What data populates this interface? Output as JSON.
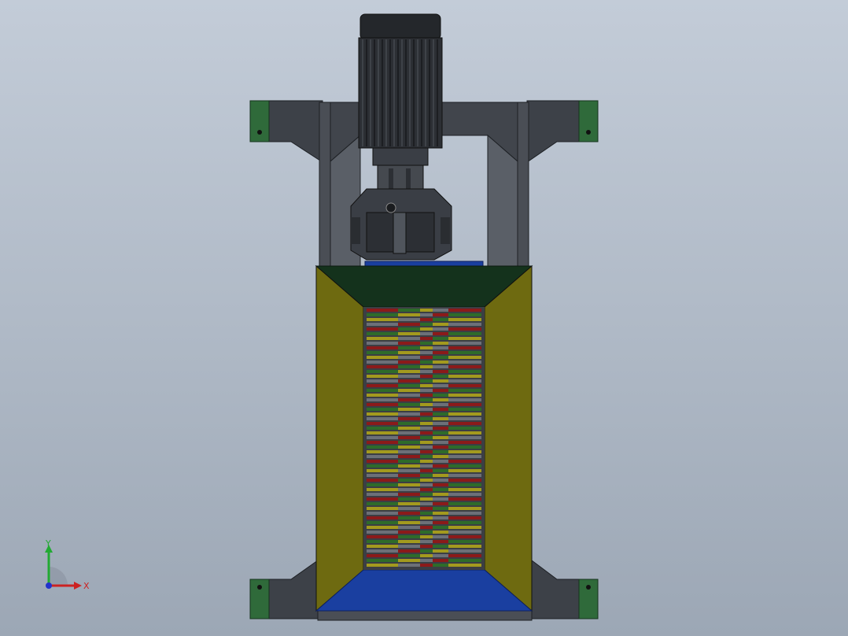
{
  "viewport": {
    "model": "shredder-assembly",
    "background_top": "#c3ccd8",
    "background_bottom": "#9ca7b5"
  },
  "colors": {
    "frame": "#3d4148",
    "frame_light": "#5a5f67",
    "motor": "#2c2f34",
    "gearbox": "#3a3e45",
    "hopper_yellow": "#6e6a10",
    "hopper_yellow_light": "#8a8418",
    "hopper_green": "#14321c",
    "hopper_blue": "#1a3fa0",
    "base_green": "#2f6a3a",
    "blade_red": "#8b1a1a",
    "blade_green": "#2e6b2a",
    "blade_yellow": "#a39a1e",
    "blade_gray": "#6c7078"
  },
  "triad": {
    "x_label": "X",
    "y_label": "Y",
    "x_color": "#cc2222",
    "y_color": "#22aa33",
    "z_color": "#2233cc"
  }
}
